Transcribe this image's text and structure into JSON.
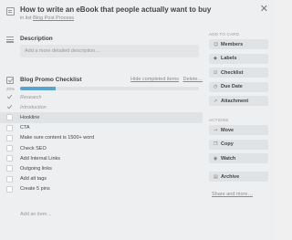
{
  "card": {
    "title": "How to write an eBook that people actually want to buy",
    "list_prefix": "in list ",
    "list_name": "Blog Post Process",
    "close": "✕"
  },
  "description": {
    "heading": "Description",
    "placeholder": "Add a more detailed description…"
  },
  "checklist": {
    "heading": "Blog Promo Checklist",
    "hide_completed": "Hide completed items",
    "delete": "Delete…",
    "percent_label": "20%",
    "progress": 0.2,
    "items": [
      {
        "label": "Research",
        "done": true
      },
      {
        "label": "Introduction",
        "done": true
      },
      {
        "label": "Hookline",
        "done": false
      },
      {
        "label": "CTA",
        "done": false
      },
      {
        "label": "Make sure content is 1500+ word",
        "done": false
      },
      {
        "label": "Check SEO",
        "done": false
      },
      {
        "label": "Add Internal Links",
        "done": false
      },
      {
        "label": "Outgoing links",
        "done": false
      },
      {
        "label": "Add alt tags",
        "done": false
      },
      {
        "label": "Create 5 pins",
        "done": false
      }
    ],
    "add_item": "Add an item…"
  },
  "sidebar": {
    "add_to_card_heading": "ADD TO CARD",
    "add_buttons": [
      {
        "label": "Members",
        "icon": "person-icon"
      },
      {
        "label": "Labels",
        "icon": "tag-icon"
      },
      {
        "label": "Checklist",
        "icon": "checklist-icon"
      },
      {
        "label": "Due Date",
        "icon": "clock-icon"
      },
      {
        "label": "Attachment",
        "icon": "paperclip-icon"
      }
    ],
    "actions_heading": "ACTIONS",
    "action_buttons": [
      {
        "label": "Move",
        "icon": "arrow-right-icon"
      },
      {
        "label": "Copy",
        "icon": "copy-icon"
      },
      {
        "label": "Watch",
        "icon": "eye-icon"
      },
      {
        "label": "Archive",
        "icon": "archive-icon"
      }
    ],
    "share": "Share and more…"
  },
  "colors": {
    "progress": "#5ba4cf",
    "background": "#edeff0",
    "button": "#dfe3e6"
  }
}
